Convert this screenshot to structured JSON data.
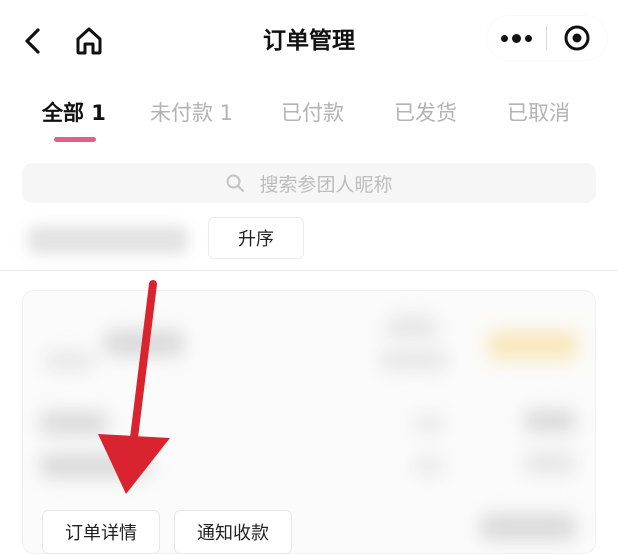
{
  "header": {
    "title": "订单管理",
    "back_icon": "chevron-left-icon",
    "home_icon": "home-icon",
    "more_icon": "more-dots-icon",
    "close_icon": "target-circle-icon"
  },
  "tabs": [
    {
      "label": "全部 1",
      "active": true
    },
    {
      "label": "未付款 1",
      "active": false
    },
    {
      "label": "已付款",
      "active": false
    },
    {
      "label": "已发货",
      "active": false
    },
    {
      "label": "已取消",
      "active": false
    }
  ],
  "search": {
    "placeholder": "搜索参团人昵称",
    "icon": "search-icon"
  },
  "sort": {
    "button_label": "升序"
  },
  "order": {
    "detail_button": "订单详情",
    "notify_button": "通知收款"
  },
  "colors": {
    "accent_underline": "#e0608a",
    "annotation_arrow": "#d9232e",
    "inactive_tab": "#b3b3b3"
  }
}
